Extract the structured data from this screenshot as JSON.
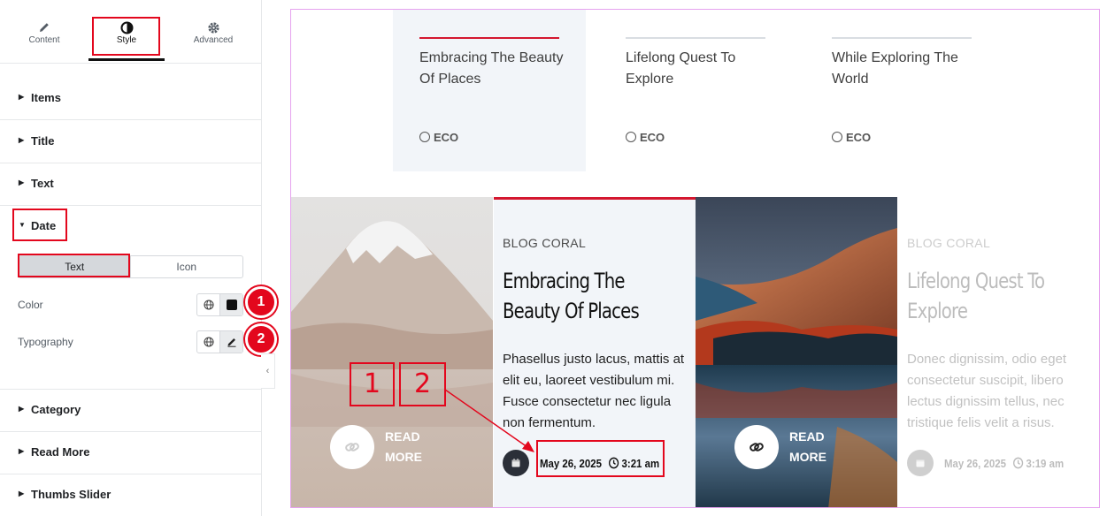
{
  "panel": {
    "tabs": [
      {
        "label": "Content",
        "icon": "pencil-icon"
      },
      {
        "label": "Style",
        "icon": "contrast-icon"
      },
      {
        "label": "Advanced",
        "icon": "gear-icon"
      }
    ],
    "sections": {
      "items": "Items",
      "title": "Title",
      "text": "Text",
      "date": "Date",
      "category": "Category",
      "read_more": "Read More",
      "thumbs_slider": "Thumbs Slider"
    },
    "date_controls": {
      "segment": [
        "Text",
        "Icon"
      ],
      "color_label": "Color",
      "typography_label": "Typography"
    },
    "badges": [
      "1",
      "2"
    ]
  },
  "preview": {
    "thumbs": [
      {
        "title": "Embracing The Beauty Of Places",
        "category": "ECO"
      },
      {
        "title": "Lifelong Quest To Explore",
        "category": "ECO"
      },
      {
        "title": "While Exploring The World",
        "category": "ECO"
      }
    ],
    "slides": [
      {
        "category": "BLOG CORAL",
        "title": "Embracing The Beauty Of Places",
        "text": "Phasellus justo lacus, mattis at elit eu, laoreet vestibulum mi. Fusce consectetur nec ligula non fermentum.",
        "date": "May 26, 2025",
        "time": "3:21 am",
        "read_more": [
          "READ",
          "MORE"
        ]
      },
      {
        "category": "BLOG CORAL",
        "title": "Lifelong Quest To Explore",
        "text": "Donec dignissim, odio eget consectetur suscipit, libero lectus dignissim tellus, nec tristique felis velit a risus.",
        "date": "May 26, 2025",
        "time": "3:19 am",
        "read_more": [
          "READ",
          "MORE"
        ]
      }
    ],
    "annotation_labels": [
      "1",
      "2"
    ]
  },
  "colors": {
    "accent": "#d4172f",
    "annotation_red": "#e3071d",
    "canvas_border": "#e6a2ef"
  }
}
